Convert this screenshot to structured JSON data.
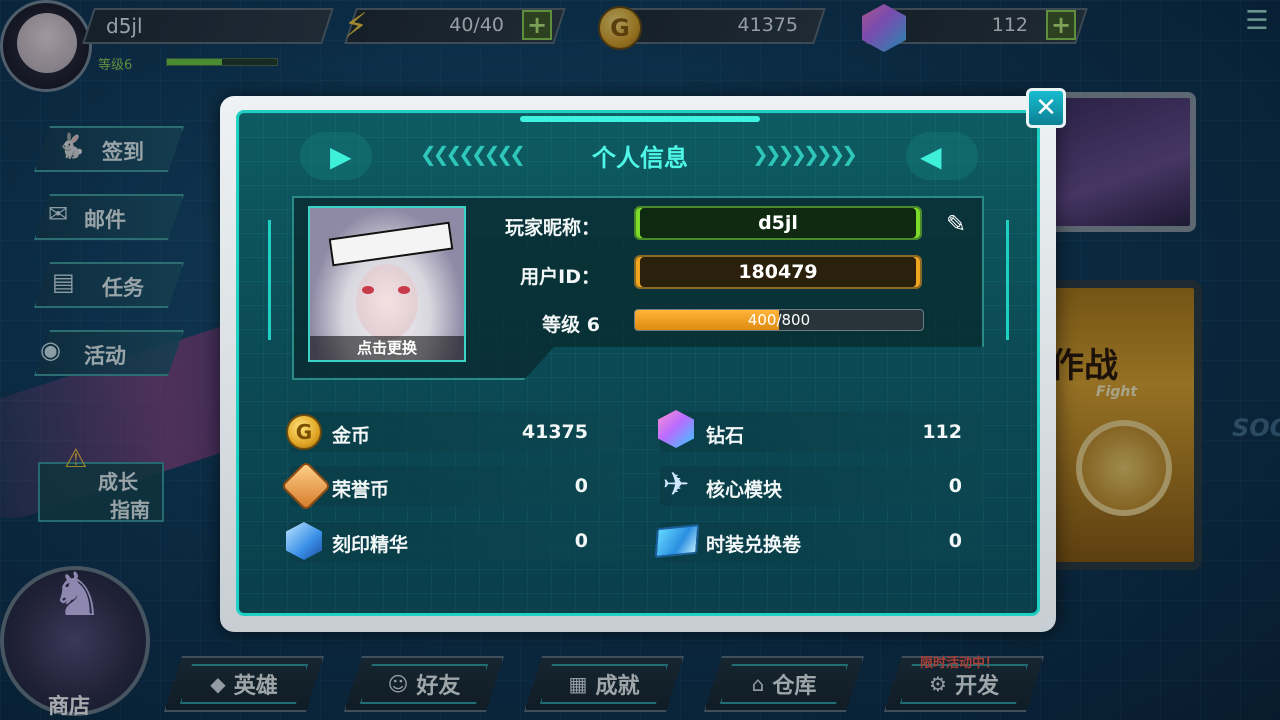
{
  "top_bar": {
    "player_name": "d5jl",
    "level_label": "等级6",
    "energy": "40/40",
    "gold": "41375",
    "diamond": "112",
    "level_progress": 0.5
  },
  "side_menu": [
    {
      "label": "签到",
      "icon": "rabbit-icon"
    },
    {
      "label": "邮件",
      "icon": "mail-icon"
    },
    {
      "label": "任务",
      "icon": "task-icon"
    },
    {
      "label": "活动",
      "icon": "activity-icon"
    }
  ],
  "growth_guide": {
    "line1": "成长",
    "line2": "指南"
  },
  "right_panel": {
    "fight_cn": "作战",
    "fight_en": "Fight",
    "bg_text": "SOO"
  },
  "bottom_nav": [
    {
      "label": "英雄",
      "icon": "hero-icon"
    },
    {
      "label": "好友",
      "icon": "friends-icon"
    },
    {
      "label": "成就",
      "icon": "achievement-icon"
    },
    {
      "label": "仓库",
      "icon": "warehouse-icon"
    },
    {
      "label": "开发",
      "icon": "develop-icon"
    }
  ],
  "limited_event": "限时活动中！",
  "shop_label": "商店",
  "dialog": {
    "title": "个人信息",
    "close": "✕",
    "portrait_caption": "点击更换",
    "nickname_label": "玩家昵称：",
    "nickname_value": "d5jl",
    "userid_label": "用户ID：",
    "userid_value": "180479",
    "level_label": "等级 6",
    "xp_text": "400/800",
    "xp_progress": 0.5,
    "stats_left": [
      {
        "label": "金币",
        "value": "41375",
        "icon": "gold-coin-icon"
      },
      {
        "label": "荣誉币",
        "value": "0",
        "icon": "honor-coin-icon"
      },
      {
        "label": "刻印精华",
        "value": "0",
        "icon": "engrave-essence-icon"
      }
    ],
    "stats_right": [
      {
        "label": "钻石",
        "value": "112",
        "icon": "diamond-icon"
      },
      {
        "label": "核心模块",
        "value": "0",
        "icon": "core-module-icon"
      },
      {
        "label": "时装兑换卷",
        "value": "0",
        "icon": "costume-ticket-icon"
      }
    ]
  }
}
